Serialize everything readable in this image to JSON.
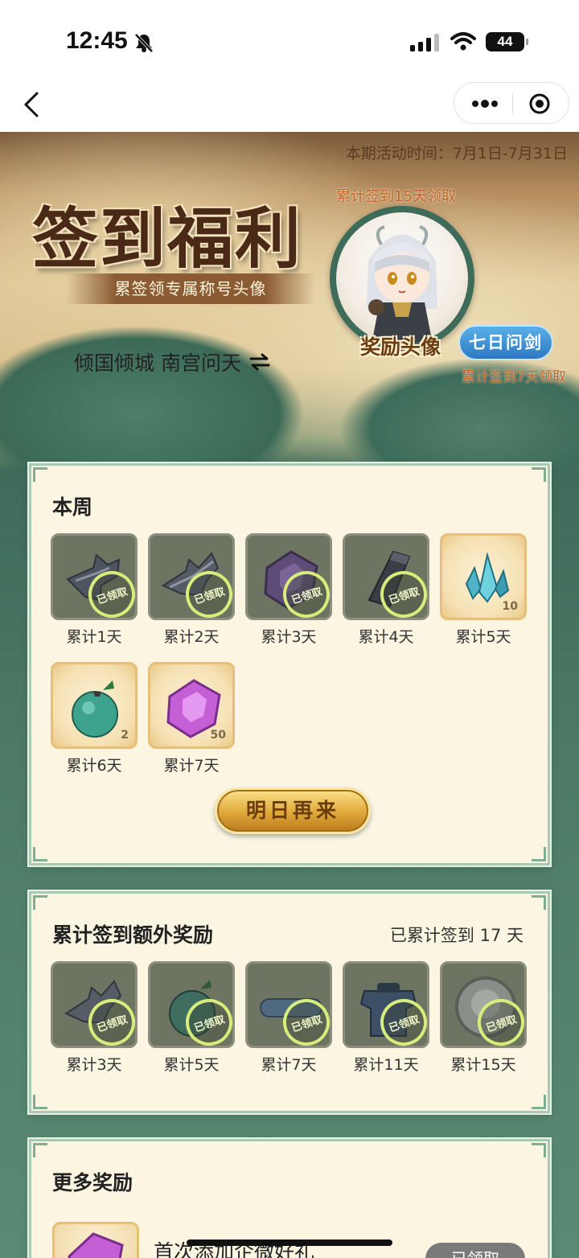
{
  "status_bar": {
    "time": "12:45",
    "battery": "44"
  },
  "nav": {
    "back": "back",
    "more": "more",
    "close": "close"
  },
  "banner": {
    "event_time": "本期活动时间：7月1日-7月31日",
    "title": "签到福利",
    "subtitle": "累签领专属称号头像",
    "title_name": "倾国倾城 南宫问天",
    "avatar_note": "累计签到15天领取",
    "avatar_label": "奖励头像",
    "title_badge": "七日问剑",
    "title_note": "累计签到7天领取"
  },
  "weekly": {
    "title": "本周",
    "stamp": "已领取",
    "items": [
      {
        "label": "累计1天",
        "claimed": true
      },
      {
        "label": "累计2天",
        "claimed": true
      },
      {
        "label": "累计3天",
        "claimed": true
      },
      {
        "label": "累计4天",
        "claimed": true
      },
      {
        "label": "累计5天",
        "claimed": false,
        "count": "10"
      },
      {
        "label": "累计6天",
        "claimed": false,
        "count": "2"
      },
      {
        "label": "累计7天",
        "claimed": false,
        "count": "50"
      }
    ],
    "button": "明日再来"
  },
  "cumulative": {
    "title": "累计签到额外奖励",
    "summary": "已累计签到 17 天",
    "stamp": "已领取",
    "items": [
      {
        "label": "累计3天",
        "claimed": true
      },
      {
        "label": "累计5天",
        "claimed": true
      },
      {
        "label": "累计7天",
        "claimed": true
      },
      {
        "label": "累计11天",
        "claimed": true
      },
      {
        "label": "累计15天",
        "claimed": true
      }
    ]
  },
  "more": {
    "title": "更多奖励",
    "item_title": "首次添加企微好礼",
    "item_button": "已领取"
  },
  "colors": {
    "accent_green": "#3f6b5a",
    "card_bg": "#fbf5e2",
    "badge_blue": "#2d78c0",
    "gold": "#e0a83a"
  }
}
